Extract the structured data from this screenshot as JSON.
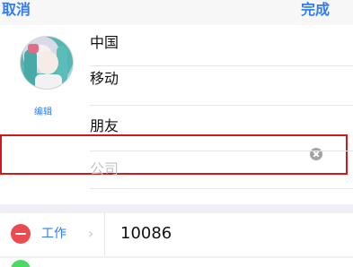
{
  "nav": {
    "cancel": "取消",
    "done": "完成"
  },
  "contact": {
    "edit_label": "编辑",
    "fields": [
      {
        "value": "中国",
        "placeholder": ""
      },
      {
        "value": "移动",
        "placeholder": ""
      },
      {
        "value": "朋友",
        "placeholder": ""
      },
      {
        "value": "",
        "placeholder": "公司"
      }
    ]
  },
  "phone": {
    "label": "工作",
    "chevron": "›",
    "value": "10086"
  },
  "colors": {
    "accent": "#2f7cf6",
    "highlight": "#d7161c",
    "delete": "#ea4b4e",
    "add": "#4cd964"
  }
}
